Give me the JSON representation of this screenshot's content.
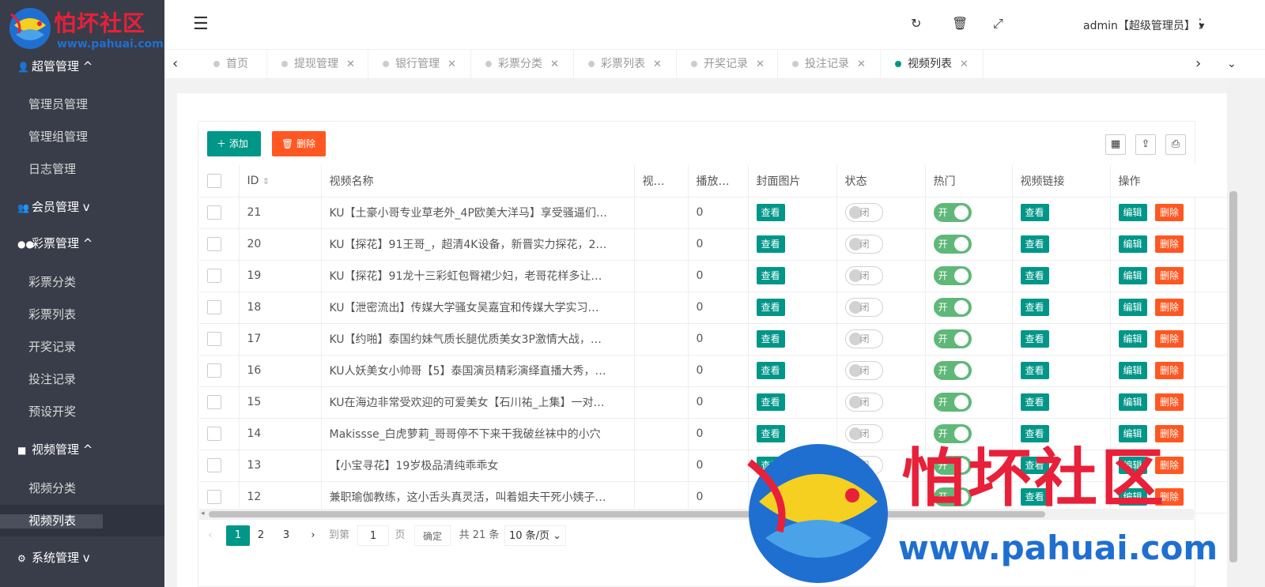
{
  "logo": {
    "brand": "怕坏社区",
    "url": "www.pahuai.com"
  },
  "sidebar": {
    "groups": [
      {
        "label": "超管管理",
        "arrow": "^",
        "items": [
          "管理员管理",
          "管理组管理",
          "日志管理"
        ]
      },
      {
        "label": "会员管理",
        "arrow": "v",
        "items": []
      },
      {
        "label": "彩票管理",
        "arrow": "^",
        "items": [
          "彩票分类",
          "彩票列表",
          "开奖记录",
          "投注记录",
          "预设开奖"
        ]
      },
      {
        "label": "视频管理",
        "arrow": "^",
        "items": [
          "视频分类",
          "视频列表"
        ]
      },
      {
        "label": "系统管理",
        "arrow": "v",
        "items": []
      }
    ],
    "active_item": "视频列表"
  },
  "header": {
    "user": "admin【超级管理员】",
    "icons": [
      "refresh-icon",
      "trash-icon",
      "fullscreen-icon",
      "more-icon"
    ]
  },
  "tabs": [
    {
      "label": "首页",
      "closable": false
    },
    {
      "label": "提现管理",
      "closable": true
    },
    {
      "label": "银行管理",
      "closable": true
    },
    {
      "label": "彩票分类",
      "closable": true
    },
    {
      "label": "彩票列表",
      "closable": true
    },
    {
      "label": "开奖记录",
      "closable": true
    },
    {
      "label": "投注记录",
      "closable": true
    },
    {
      "label": "视频列表",
      "closable": true,
      "active": true
    }
  ],
  "toolbar": {
    "add_label": "添加",
    "delete_label": "删除"
  },
  "table": {
    "columns": [
      "",
      "ID",
      "视频名称",
      "视…",
      "播放…",
      "封面图片",
      "状态",
      "热门",
      "视频链接",
      "操作"
    ],
    "view_label": "查看",
    "edit_label": "编辑",
    "delete_label": "删除",
    "switch_on_label": "开",
    "switch_off_label": "闭",
    "rows": [
      {
        "id": "21",
        "name": "KU【土豪小哥专业草老外_4P欧美大洋马】享受骚逼们…",
        "col3": "",
        "plays": "0",
        "status": "off",
        "hot": "on"
      },
      {
        "id": "20",
        "name": "KU【探花】91王哥_，超清4K设备，新晋实力探花，2…",
        "col3": "",
        "plays": "0",
        "status": "off",
        "hot": "on"
      },
      {
        "id": "19",
        "name": "KU【探花】91龙十三彩虹包臀裙少妇，老哥花样多让…",
        "col3": "",
        "plays": "0",
        "status": "off",
        "hot": "on"
      },
      {
        "id": "18",
        "name": "KU【泄密流出】传媒大学骚女吴嘉宜和传媒大学实习…",
        "col3": "",
        "plays": "0",
        "status": "off",
        "hot": "on"
      },
      {
        "id": "17",
        "name": "KU【约啪】泰国约妹气质长腿优质美女3P激情大战，…",
        "col3": "",
        "plays": "0",
        "status": "off",
        "hot": "on"
      },
      {
        "id": "16",
        "name": "KU人妖美女小帅哥【5】泰国演员精彩演绎直播大秀，…",
        "col3": "",
        "plays": "0",
        "status": "off",
        "hot": "on"
      },
      {
        "id": "15",
        "name": "KU在海边非常受欢迎的可爱美女【石川祐_上集】一对…",
        "col3": "",
        "plays": "0",
        "status": "off",
        "hot": "on"
      },
      {
        "id": "14",
        "name": "Makissse_白虎萝莉_哥哥停不下来干我破丝袜中的小穴",
        "col3": "",
        "plays": "0",
        "status": "off",
        "hot": "on"
      },
      {
        "id": "13",
        "name": "【小宝寻花】19岁极品清纯乖乖女",
        "col3": "",
        "plays": "0",
        "status": "off",
        "hot": "on"
      },
      {
        "id": "12",
        "name": "兼职瑜伽教练，这小舌头真灵活，叫着姐夫干死小姨子…",
        "col3": "",
        "plays": "0",
        "status": "off",
        "hot": "on"
      }
    ]
  },
  "pager": {
    "pages": [
      "1",
      "2",
      "3"
    ],
    "current": "1",
    "goto_label": "到第",
    "goto_value": "1",
    "page_unit": "页",
    "confirm_label": "确定",
    "total": "共 21 条",
    "page_size": "10 条/页"
  },
  "watermark": {
    "brand": "怕坏社区",
    "url": "www.pahuai.com"
  },
  "colors": {
    "primary": "#009688",
    "danger": "#ff5722",
    "switch_on": "#5fb878",
    "sidebar": "#393d49",
    "brand_red": "#e8203a",
    "brand_blue": "#1f6fd1"
  }
}
